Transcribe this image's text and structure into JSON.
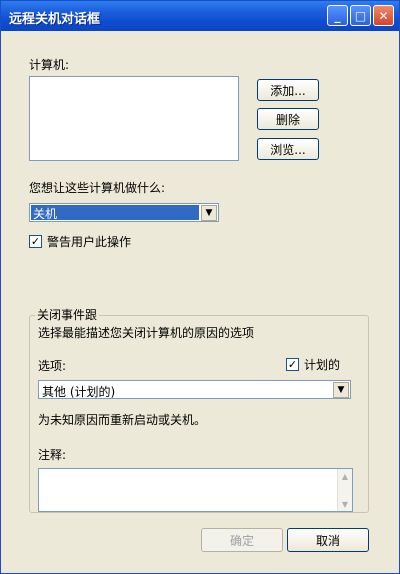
{
  "window": {
    "title": "远程关机对话框",
    "buttons": {
      "minimize": "_",
      "maximize": "□",
      "close": "✕"
    }
  },
  "computers": {
    "label": "计算机:",
    "add_label": "添加...",
    "remove_label": "删除",
    "browse_label": "浏览..."
  },
  "action": {
    "label": "您想让这些计算机做什么:",
    "selected": "关机",
    "warn_checkbox": {
      "checked": true,
      "label": "警告用户此操作"
    }
  },
  "event_tracker": {
    "title": "关闭事件跟",
    "description": "选择最能描述您关闭计算机的原因的选项",
    "option_label": "选项:",
    "planned": {
      "checked": true,
      "label": "计划的"
    },
    "selected_option": "其他 (计划的)",
    "reason_text": "为未知原因而重新启动或关机。",
    "comment_label": "注释:"
  },
  "footer": {
    "ok_label": "确定",
    "cancel_label": "取消"
  }
}
